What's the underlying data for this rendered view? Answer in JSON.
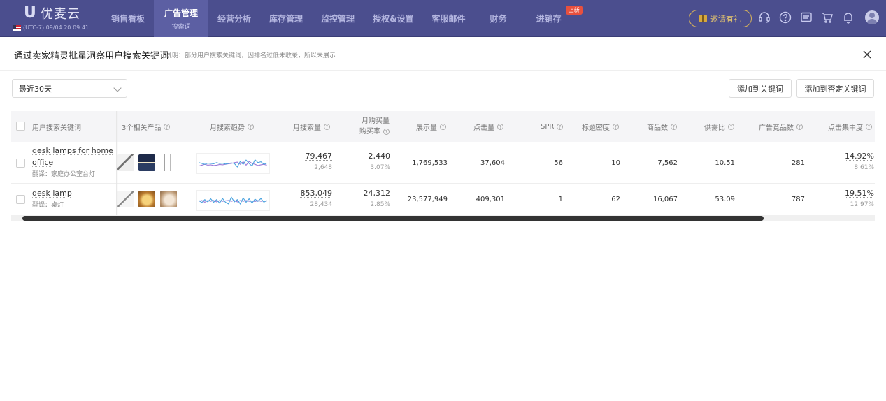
{
  "app": {
    "brand": "优麦云",
    "timezone": "(UTC-7) 09/04 20:09:41"
  },
  "nav": {
    "items": [
      {
        "label": "销售看板"
      },
      {
        "label": "广告管理",
        "sub": "搜索词",
        "active": true
      },
      {
        "label": "经营分析"
      },
      {
        "label": "库存管理"
      },
      {
        "label": "监控管理"
      },
      {
        "label": "授权&设置"
      },
      {
        "label": "客服邮件"
      },
      {
        "label": "财务"
      },
      {
        "label": "进销存",
        "badge": "上新"
      }
    ],
    "invite_label": "邀请有礼",
    "icons": [
      "headset-icon",
      "help-icon",
      "message-icon",
      "cart-icon",
      "bell-icon",
      "avatar-icon"
    ]
  },
  "dialog": {
    "title": "通过卖家精灵批量洞察用户搜索关键词",
    "note": "说明：部分用户搜索关键词，因排名过低未收录，所以未展示"
  },
  "controls": {
    "range_selected": "最近30天",
    "add_keyword_label": "添加到关键词",
    "add_negative_label": "添加到否定关键词"
  },
  "table": {
    "headers": {
      "keyword": "用户搜索关键词",
      "products": "3个相关产品",
      "trend": "月搜索趋势",
      "monthly_search": "月搜索量",
      "monthly_buy_1": "月购买量",
      "monthly_buy_2": "购买率",
      "impressions": "展示量",
      "clicks": "点击量",
      "spr": "SPR",
      "title_density": "标题密度",
      "product_count": "商品数",
      "supply_demand": "供需比",
      "ad_products": "广告竞品数",
      "click_concentration": "点击集中度"
    },
    "rows": [
      {
        "keyword_line1": "desk lamps for home",
        "keyword_line2": "office",
        "translation": "翻译：家庭办公室台灯",
        "monthly_search": "79,467",
        "monthly_search_sub": "2,648",
        "monthly_buy": "2,440",
        "buy_rate": "3.07%",
        "impressions": "1,769,533",
        "clicks": "37,604",
        "spr": "56",
        "title_density": "10",
        "product_count": "7,562",
        "supply_demand": "10.51",
        "ad_products": "281",
        "click_concentration": "14.92%",
        "click_concentration_sub": "8.61%",
        "trend": [
          0.55,
          0.5,
          0.45,
          0.52,
          0.5,
          0.48,
          0.55,
          0.5,
          0.52,
          0.47,
          0.5,
          0.53,
          0.5,
          0.3,
          0.62,
          0.45,
          0.7,
          0.5,
          0.35,
          0.72,
          0.55,
          0.6,
          0.45,
          0.52
        ],
        "trend2": [
          0.35,
          0.4,
          0.45,
          0.4,
          0.42,
          0.38,
          0.4,
          0.44,
          0.42,
          0.45,
          0.48,
          0.5,
          0.55,
          0.58,
          0.45,
          0.6,
          0.4,
          0.62,
          0.5,
          0.45,
          0.38,
          0.42,
          0.45,
          0.4
        ]
      },
      {
        "keyword_line1": "desk lamp",
        "keyword_line2": "",
        "translation": "翻译：桌灯",
        "monthly_search": "853,049",
        "monthly_search_sub": "28,434",
        "monthly_buy": "24,312",
        "buy_rate": "2.85%",
        "impressions": "23,577,949",
        "clicks": "409,301",
        "spr": "1",
        "title_density": "62",
        "product_count": "16,067",
        "supply_demand": "53.09",
        "ad_products": "787",
        "click_concentration": "19.51%",
        "click_concentration_sub": "12.97%",
        "trend": [
          0.5,
          0.38,
          0.55,
          0.42,
          0.6,
          0.4,
          0.55,
          0.35,
          0.62,
          0.4,
          0.3,
          0.7,
          0.42,
          0.55,
          0.3,
          0.65,
          0.4,
          0.6,
          0.35,
          0.58,
          0.45,
          0.62,
          0.4,
          0.5
        ],
        "trend2": [
          0.45,
          0.5,
          0.4,
          0.5,
          0.45,
          0.5,
          0.42,
          0.5,
          0.45,
          0.48,
          0.5,
          0.45,
          0.5,
          0.42,
          0.5,
          0.45,
          0.5,
          0.45,
          0.48,
          0.44,
          0.5,
          0.45,
          0.48,
          0.46
        ]
      }
    ]
  },
  "colors": {
    "nav_bg": "#4b4e8e",
    "nav_active": "#5c5fa3",
    "trend_primary": "#4aa3df",
    "trend_secondary": "#9b7bd8"
  }
}
